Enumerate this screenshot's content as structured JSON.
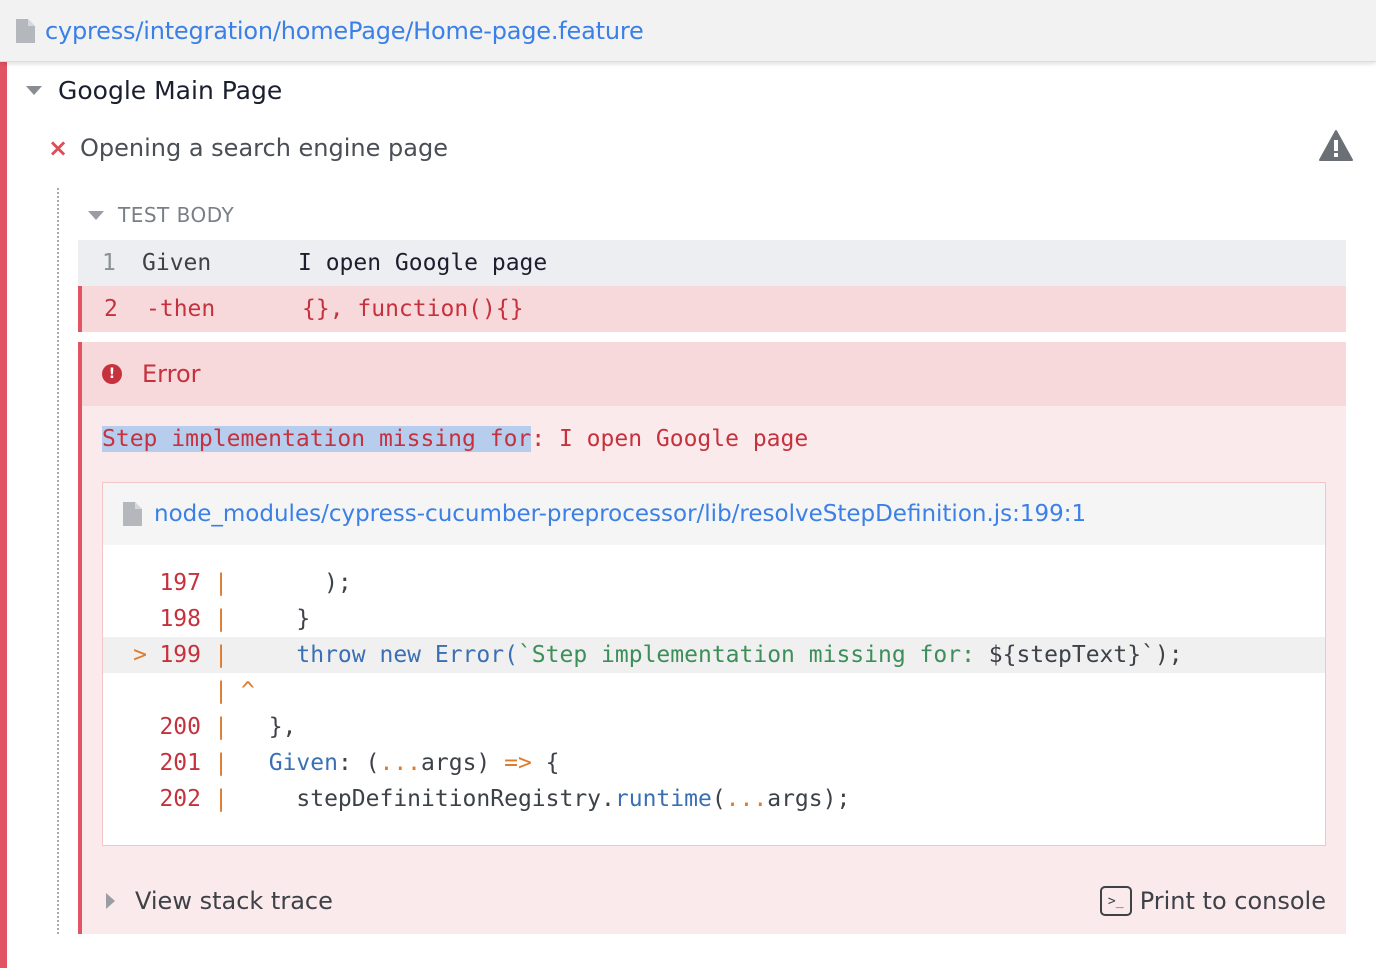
{
  "header": {
    "spec_path": "cypress/integration/homePage/Home-page.feature",
    "icon": "file-icon"
  },
  "suite": {
    "title": "Google Main Page"
  },
  "test": {
    "status_icon": "×",
    "title": "Opening a search engine page"
  },
  "hook": {
    "title": "TEST BODY"
  },
  "commands": [
    {
      "number": "1",
      "name": "Given",
      "message": "I open Google page"
    },
    {
      "number": "2",
      "name": "-then",
      "message": "{}, function(){}"
    }
  ],
  "error": {
    "badge": "!",
    "name": "Error",
    "message_highlight": "Step implementation missing for",
    "message_rest": ": I open Google page",
    "file_link": "node_modules/cypress-cucumber-preprocessor/lib/resolveStepDefinition.js:199:1",
    "code_lines": [
      {
        "marker": "",
        "num": "197",
        "bar": "|",
        "code": "      );"
      },
      {
        "marker": "",
        "num": "198",
        "bar": "|",
        "code": "    }"
      },
      {
        "marker": ">",
        "num": "199",
        "bar": "|",
        "code_throw": "    throw new Error(",
        "code_str": "`Step implementation missing for: ",
        "code_var": "${stepText}",
        "code_end": "`);"
      },
      {
        "marker": "",
        "num": "",
        "bar": "|",
        "code_caret": "^"
      },
      {
        "marker": "",
        "num": "200",
        "bar": "|",
        "code": "  },"
      },
      {
        "marker": "",
        "num": "201",
        "bar": "|",
        "code_given": "  Given",
        "code_given_rest": ": (",
        "code_spread": "...",
        "code_args": "args) ",
        "code_arrow": "=>",
        "code_brace": " {"
      },
      {
        "marker": "",
        "num": "202",
        "bar": "|",
        "code_reg": "    stepDefinitionRegistry.",
        "code_runtime": "runtime",
        "code_open": "(",
        "code_spread2": "...",
        "code_close": "args);"
      }
    ],
    "stack_label": "View stack trace",
    "print_label": "Print to console",
    "terminal_glyph": ">_"
  }
}
